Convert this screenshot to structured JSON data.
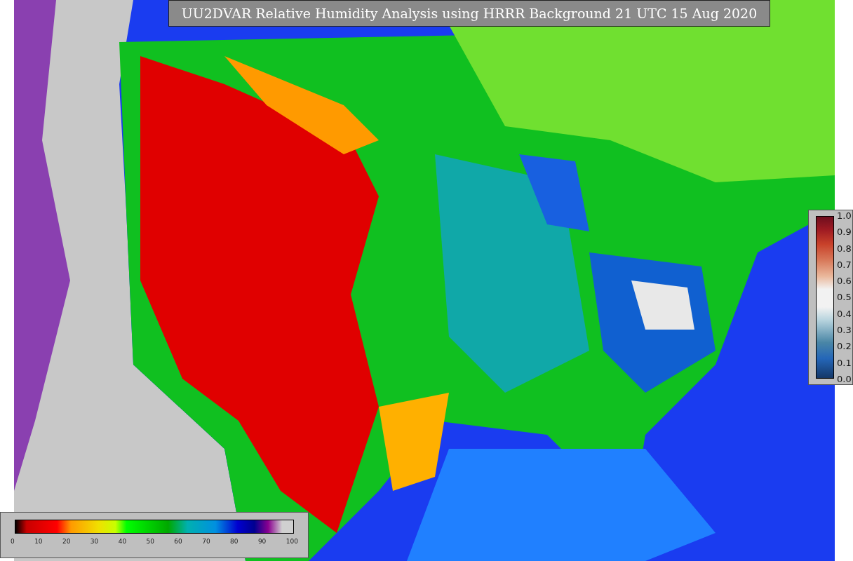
{
  "title": "UU2DVAR Relative Humidity Analysis using HRRR Background 21 UTC 15 Aug 2020",
  "side_colorbar": {
    "ticks": [
      "1.0",
      "0.9",
      "0.8",
      "0.7",
      "0.6",
      "0.5",
      "0.4",
      "0.3",
      "0.2",
      "0.1",
      "0.0"
    ]
  },
  "bottom_colorbar": {
    "ticks": [
      "0",
      "10",
      "20",
      "30",
      "40",
      "50",
      "60",
      "70",
      "80",
      "90",
      "100"
    ]
  }
}
